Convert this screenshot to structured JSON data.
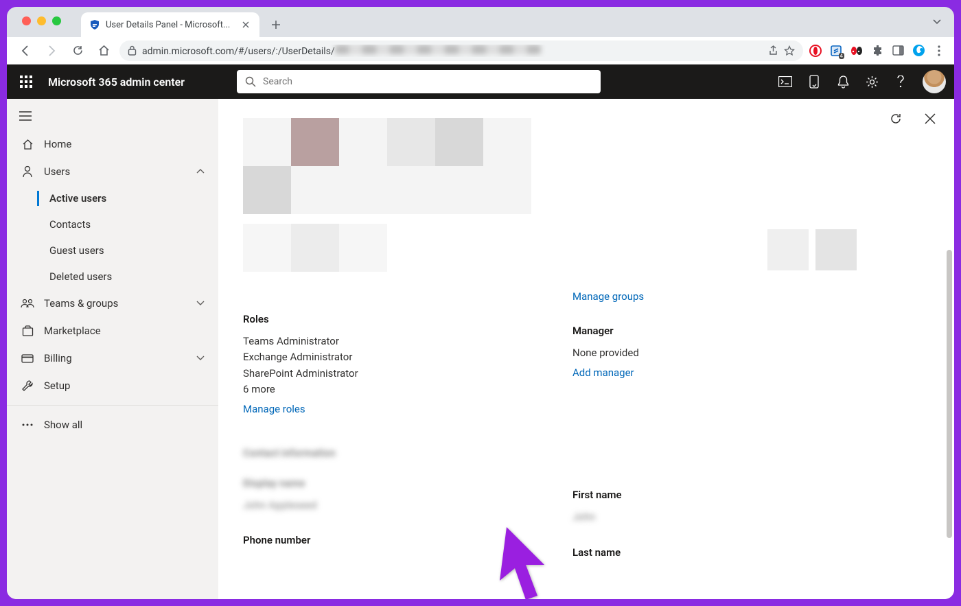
{
  "browser": {
    "tab_title": "User Details Panel - Microsoft...",
    "url_visible": "admin.microsoft.com/#/users/:/UserDetails/"
  },
  "header": {
    "app_title": "Microsoft 365 admin center",
    "search_placeholder": "Search"
  },
  "sidebar": {
    "home": "Home",
    "users": "Users",
    "users_sub": {
      "active": "Active users",
      "contacts": "Contacts",
      "guest": "Guest users",
      "deleted": "Deleted users"
    },
    "teams": "Teams & groups",
    "marketplace": "Marketplace",
    "billing": "Billing",
    "setup": "Setup",
    "show_all": "Show all"
  },
  "panel": {
    "manage_groups": "Manage groups",
    "roles": {
      "heading": "Roles",
      "list": [
        "Teams Administrator",
        "Exchange Administrator",
        "SharePoint Administrator"
      ],
      "more": "6 more",
      "manage": "Manage roles"
    },
    "manager": {
      "heading": "Manager",
      "value": "None provided",
      "add": "Add manager"
    },
    "contact_heading_blur": "Contact information",
    "display_label_blur": "Display name",
    "display_value_blur": "John Appleseed",
    "first_name": "First name",
    "first_value_blur": "John",
    "phone": "Phone number",
    "last_name": "Last name"
  }
}
